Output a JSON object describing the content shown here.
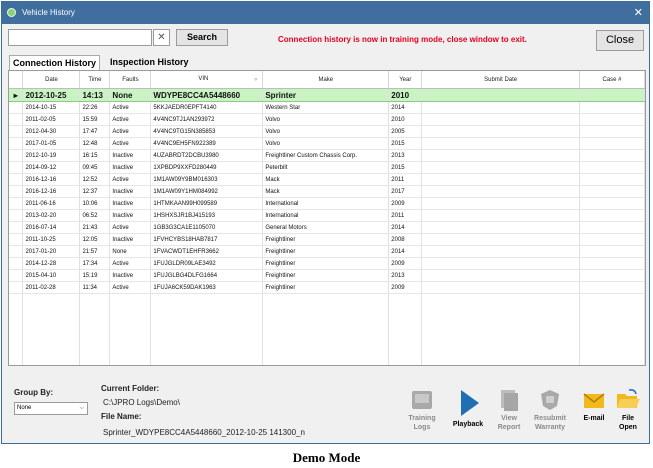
{
  "window": {
    "title": "Vehicle History",
    "close_glyph": "✕"
  },
  "search": {
    "value": "",
    "clear_glyph": "✕",
    "button_label": "Search"
  },
  "notice": "Connection history is now in training mode, close window to exit.",
  "close_button_label": "Close",
  "tabs": [
    {
      "label": "Connection History",
      "active": true
    },
    {
      "label": "Inspection History",
      "active": false
    }
  ],
  "table": {
    "columns": [
      "Date",
      "Time",
      "Faults",
      "VIN",
      "Make",
      "Year",
      "Submit Date",
      "Case #"
    ],
    "rows": [
      {
        "date": "2012-10-25",
        "time": "14:13",
        "faults": "None",
        "vin": "WDYPE8CC4A5448660",
        "make": "Sprinter",
        "year": "2010",
        "submit": "",
        "case": "",
        "selected": true
      },
      {
        "date": "2014-10-15",
        "time": "22:26",
        "faults": "Active",
        "vin": "5KKJAEDR0EPFT4140",
        "make": "Western Star",
        "year": "2014",
        "submit": "",
        "case": ""
      },
      {
        "date": "2011-02-05",
        "time": "15:59",
        "faults": "Active",
        "vin": "4V4NC9TJ1AN293972",
        "make": "Volvo",
        "year": "2010",
        "submit": "",
        "case": ""
      },
      {
        "date": "2012-04-30",
        "time": "17:47",
        "faults": "Active",
        "vin": "4V4NC9TG15N385853",
        "make": "Volvo",
        "year": "2005",
        "submit": "",
        "case": ""
      },
      {
        "date": "2017-01-05",
        "time": "12:48",
        "faults": "Active",
        "vin": "4V4NC9EH5FN922389",
        "make": "Volvo",
        "year": "2015",
        "submit": "",
        "case": ""
      },
      {
        "date": "2012-10-19",
        "time": "16:15",
        "faults": "Inactive",
        "vin": "4UZABRDT2DCBU3980",
        "make": "Freightliner Custom Chassis Corp.",
        "year": "2013",
        "submit": "",
        "case": ""
      },
      {
        "date": "2014-09-12",
        "time": "09:45",
        "faults": "Inactive",
        "vin": "1XPBDP9XXFD280449",
        "make": "Peterbilt",
        "year": "2015",
        "submit": "",
        "case": ""
      },
      {
        "date": "2016-12-16",
        "time": "12:52",
        "faults": "Active",
        "vin": "1M1AW09Y9BM016303",
        "make": "Mack",
        "year": "2011",
        "submit": "",
        "case": ""
      },
      {
        "date": "2016-12-16",
        "time": "12:37",
        "faults": "Inactive",
        "vin": "1M1AW09Y1HM084992",
        "make": "Mack",
        "year": "2017",
        "submit": "",
        "case": ""
      },
      {
        "date": "2011-06-16",
        "time": "10:06",
        "faults": "Inactive",
        "vin": "1HTMKAAN99H099589",
        "make": "International",
        "year": "2009",
        "submit": "",
        "case": ""
      },
      {
        "date": "2013-02-20",
        "time": "06:52",
        "faults": "Inactive",
        "vin": "1HSHXSJR1BJ415193",
        "make": "International",
        "year": "2011",
        "submit": "",
        "case": ""
      },
      {
        "date": "2016-07-14",
        "time": "21:43",
        "faults": "Active",
        "vin": "1GB3G3CA1E1105070",
        "make": "General Motors",
        "year": "2014",
        "submit": "",
        "case": ""
      },
      {
        "date": "2011-10-25",
        "time": "12:05",
        "faults": "Inactive",
        "vin": "1FVHCYBS18HAB7817",
        "make": "Freightliner",
        "year": "2008",
        "submit": "",
        "case": ""
      },
      {
        "date": "2017-01-20",
        "time": "21:57",
        "faults": "None",
        "vin": "1FVACWDT1EHFR3662",
        "make": "Freightliner",
        "year": "2014",
        "submit": "",
        "case": ""
      },
      {
        "date": "2014-12-28",
        "time": "17:34",
        "faults": "Active",
        "vin": "1FUJGLDR09LAE3492",
        "make": "Freightliner",
        "year": "2009",
        "submit": "",
        "case": ""
      },
      {
        "date": "2015-04-10",
        "time": "15:19",
        "faults": "Inactive",
        "vin": "1FUJGLBG4DLFG1664",
        "make": "Freightliner",
        "year": "2013",
        "submit": "",
        "case": ""
      },
      {
        "date": "2011-02-28",
        "time": "11:34",
        "faults": "Active",
        "vin": "1FUJA6CK59DAK1963",
        "make": "Freightliner",
        "year": "2009",
        "submit": "",
        "case": ""
      }
    ]
  },
  "groupby": {
    "label": "Group By:",
    "value": "None"
  },
  "folder": {
    "label": "Current Folder:",
    "value": "C:\\JPRO Logs\\Demo\\"
  },
  "file": {
    "label": "File Name:",
    "value": "Sprinter_WDYPE8CC4A5448660_2012-10-25  141300_n"
  },
  "toolbar": {
    "training_logs": {
      "line1": "Training",
      "line2": "Logs",
      "icon": "training-logs-icon",
      "enabled": false
    },
    "playback": {
      "line1": "Playback",
      "icon": "playback-icon",
      "enabled": true
    },
    "view_report": {
      "line1": "View",
      "line2": "Report",
      "icon": "view-report-icon",
      "enabled": false
    },
    "resubmit": {
      "line1": "Resubmit",
      "line2": "Warranty",
      "icon": "resubmit-warranty-icon",
      "enabled": false
    },
    "email": {
      "line1": "E-mail",
      "icon": "email-icon",
      "enabled": true
    },
    "file_open": {
      "line1": "File",
      "line2": "Open",
      "icon": "folder-open-icon",
      "enabled": true
    }
  },
  "caption": "Demo Mode",
  "colors": {
    "titlebar": "#3f6e9f",
    "notice": "#e8001c",
    "selected_row": "#c9f3c3"
  }
}
